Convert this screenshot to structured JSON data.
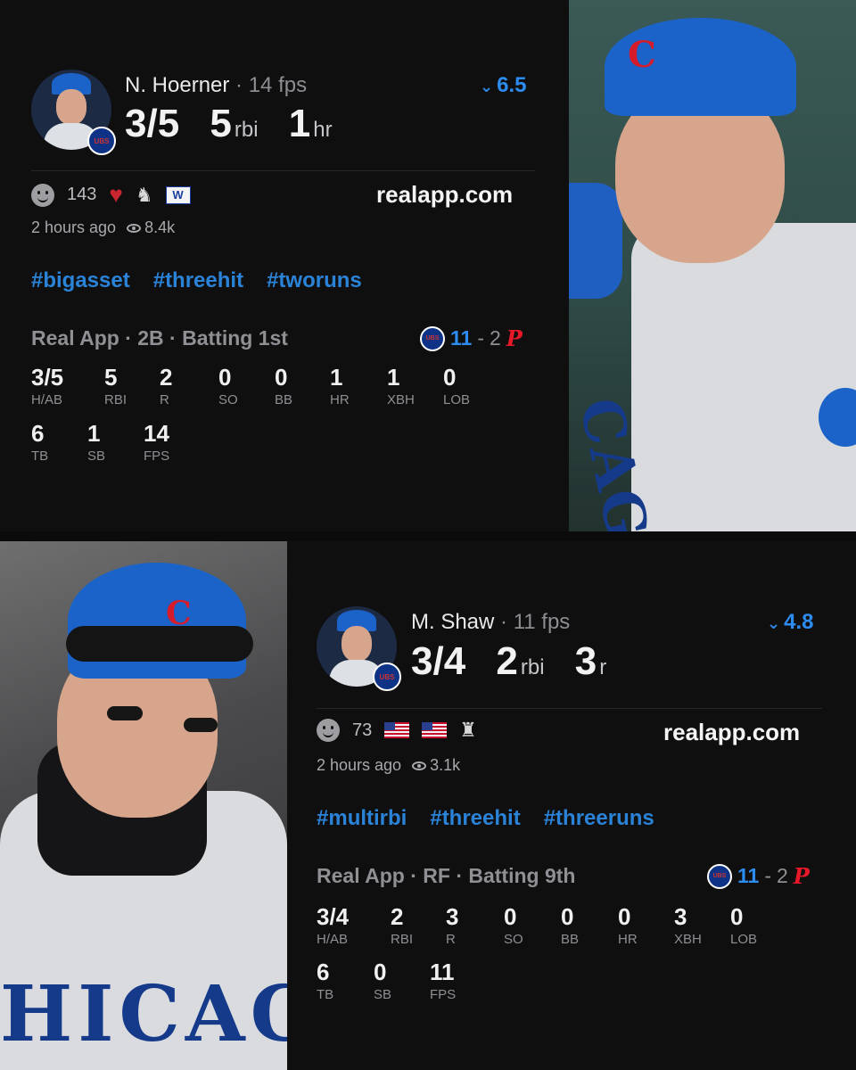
{
  "top": {
    "player_name": "N. Hoerner",
    "fps_label": " · 14 fps",
    "headline": [
      {
        "value": "3/5",
        "unit": ""
      },
      {
        "value": "5",
        "unit": "rbi"
      },
      {
        "value": "1",
        "unit": "hr"
      }
    ],
    "rating": "6.5",
    "reactions_count": "143",
    "site": "realapp.com",
    "time_ago": "2 hours ago",
    "views": "8.4k",
    "tags": [
      "#bigasset",
      "#threehit",
      "#tworuns"
    ],
    "game_line": "Real App · 2B · Batting 1st",
    "score": {
      "home": "11",
      "dash": "-",
      "away": "2"
    },
    "stats_row1": [
      {
        "v": "3/5",
        "l": "H/AB"
      },
      {
        "v": "5",
        "l": "RBI"
      },
      {
        "v": "2",
        "l": "R"
      },
      {
        "v": "0",
        "l": "SO"
      },
      {
        "v": "0",
        "l": "BB"
      },
      {
        "v": "1",
        "l": "HR"
      },
      {
        "v": "1",
        "l": "XBH"
      },
      {
        "v": "0",
        "l": "LOB"
      }
    ],
    "stats_row2": [
      {
        "v": "6",
        "l": "TB"
      },
      {
        "v": "1",
        "l": "SB"
      },
      {
        "v": "14",
        "l": "FPS"
      }
    ]
  },
  "bottom": {
    "player_name": "M. Shaw",
    "fps_label": " · 11 fps",
    "headline": [
      {
        "value": "3/4",
        "unit": ""
      },
      {
        "value": "2",
        "unit": "rbi"
      },
      {
        "value": "3",
        "unit": "r"
      }
    ],
    "rating": "4.8",
    "reactions_count": "73",
    "site": "realapp.com",
    "time_ago": "2 hours ago",
    "views": "3.1k",
    "tags": [
      "#multirbi",
      "#threehit",
      "#threeruns"
    ],
    "game_line": "Real App · RF · Batting 9th",
    "score": {
      "home": "11",
      "dash": "-",
      "away": "2"
    },
    "stats_row1": [
      {
        "v": "3/4",
        "l": "H/AB"
      },
      {
        "v": "2",
        "l": "RBI"
      },
      {
        "v": "3",
        "l": "R"
      },
      {
        "v": "0",
        "l": "SO"
      },
      {
        "v": "0",
        "l": "BB"
      },
      {
        "v": "0",
        "l": "HR"
      },
      {
        "v": "3",
        "l": "XBH"
      },
      {
        "v": "0",
        "l": "LOB"
      }
    ],
    "stats_row2": [
      {
        "v": "6",
        "l": "TB"
      },
      {
        "v": "0",
        "l": "SB"
      },
      {
        "v": "11",
        "l": "FPS"
      }
    ]
  },
  "logos": {
    "cap_letter": "C",
    "badge_text": "UBS",
    "wflag": "W",
    "phillies": "P"
  },
  "colors": {
    "rating_blue": "#2d8cf0",
    "tag_blue": "#2b83d8",
    "cubs_blue": "#0e3386",
    "heart_red": "#c9262f",
    "phillies_red": "#e81828"
  },
  "icons": [
    "smile-icon",
    "heart-icon",
    "goat-icon",
    "w-flag-icon",
    "us-flag-icon",
    "eagle-icon",
    "eye-icon",
    "rating-arrow-icon"
  ]
}
